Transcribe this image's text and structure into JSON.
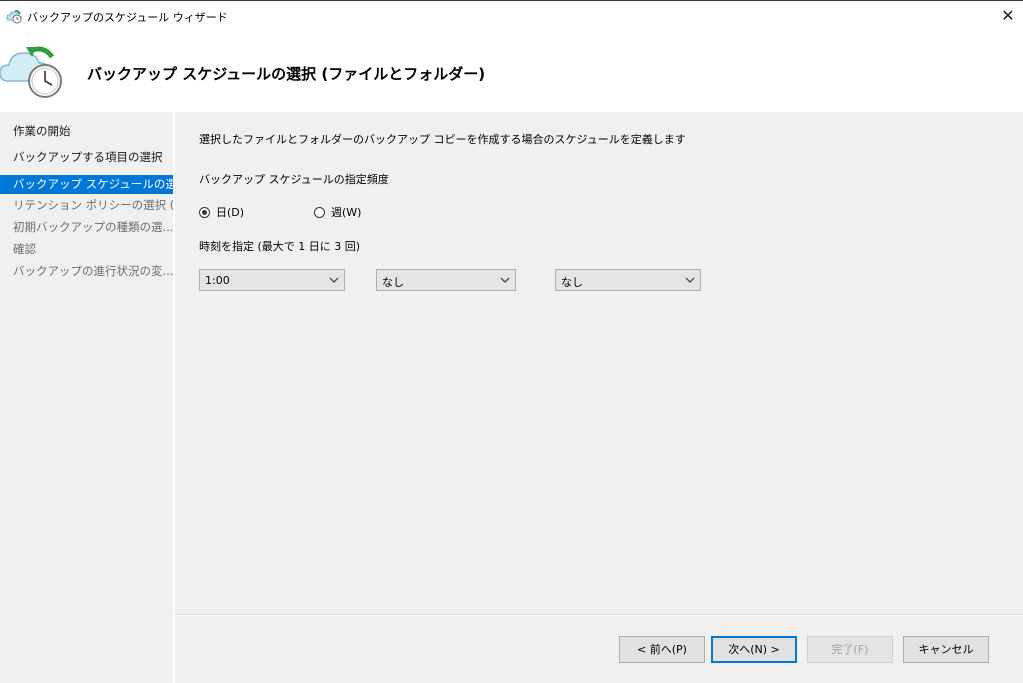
{
  "window": {
    "title": "バックアップのスケジュール ウィザード",
    "close_glyph": "✕"
  },
  "header": {
    "title": "バックアップ スケジュールの選択 (ファイルとフォルダー)",
    "icon": "backup-clock-icon"
  },
  "sidebar": {
    "items": [
      {
        "label": "作業の開始",
        "state": "done"
      },
      {
        "label": "バックアップする項目の選択",
        "state": "done"
      },
      {
        "label": "バックアップ スケジュールの選...",
        "state": "current"
      },
      {
        "label": "リテンション ポリシーの選択 (...",
        "state": "pending"
      },
      {
        "label": "初期バックアップの種類の選...",
        "state": "pending"
      },
      {
        "label": "確認",
        "state": "pending"
      },
      {
        "label": "バックアップの進行状況の変...",
        "state": "pending"
      }
    ]
  },
  "main": {
    "description": "選択したファイルとフォルダーのバックアップ コピーを作成する場合のスケジュールを定義します",
    "frequency_label": "バックアップ スケジュールの指定頻度",
    "frequency_options": [
      {
        "label": "日(D)",
        "checked": true
      },
      {
        "label": "週(W)",
        "checked": false
      }
    ],
    "times_label": "時刻を指定 (最大で 1 日に 3 回)",
    "time_selects": [
      {
        "value": "1:00"
      },
      {
        "value": "なし"
      },
      {
        "value": "なし"
      }
    ]
  },
  "footer": {
    "prev": "< 前へ(P)",
    "next": "次へ(N) >",
    "finish": "完了(F)",
    "cancel": "キャンセル"
  },
  "colors": {
    "accent": "#0078d7",
    "background": "#f0f0f0",
    "header_bg": "#ffffff"
  }
}
